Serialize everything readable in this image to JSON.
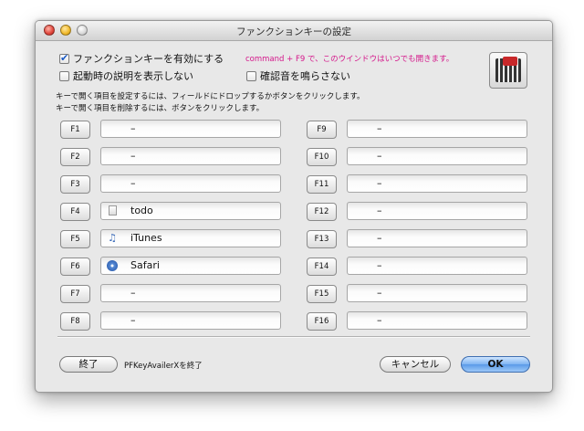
{
  "window": {
    "title": "ファンクションキーの設定"
  },
  "options": {
    "enable_label": "ファンクションキーを有効にする",
    "enable_checked": true,
    "hint": "command + F9 で、このウインドウはいつでも開きます。",
    "no_startup_desc_label": "起動時の説明を表示しない",
    "no_startup_desc_checked": false,
    "no_sound_label": "確認音を鳴らさない",
    "no_sound_checked": false
  },
  "notes": {
    "line1": "キーで開く項目を設定するには、フィールドにドロップするかボタンをクリックします。",
    "line2": "キーで開く項目を削除するには、ボタンをクリックします。"
  },
  "app_icon": "keyboard-app-icon",
  "keys_left": [
    {
      "key": "F1",
      "value": "–",
      "icon": ""
    },
    {
      "key": "F2",
      "value": "–",
      "icon": ""
    },
    {
      "key": "F3",
      "value": "–",
      "icon": ""
    },
    {
      "key": "F4",
      "value": "todo",
      "icon": "document-icon"
    },
    {
      "key": "F5",
      "value": "iTunes",
      "icon": "itunes-icon"
    },
    {
      "key": "F6",
      "value": "Safari",
      "icon": "safari-icon"
    },
    {
      "key": "F7",
      "value": "–",
      "icon": ""
    },
    {
      "key": "F8",
      "value": "–",
      "icon": ""
    }
  ],
  "keys_right": [
    {
      "key": "F9",
      "value": "–"
    },
    {
      "key": "F10",
      "value": "–"
    },
    {
      "key": "F11",
      "value": "–"
    },
    {
      "key": "F12",
      "value": "–"
    },
    {
      "key": "F13",
      "value": "–"
    },
    {
      "key": "F14",
      "value": "–"
    },
    {
      "key": "F15",
      "value": "–"
    },
    {
      "key": "F16",
      "value": "–"
    }
  ],
  "footer": {
    "quit_button": "終了",
    "quit_label": "PFKeyAvailerXを終了",
    "cancel_button": "キャンセル",
    "ok_button": "OK"
  },
  "colors": {
    "hint": "#d4168a",
    "ok_button": "#5a9ae8"
  }
}
